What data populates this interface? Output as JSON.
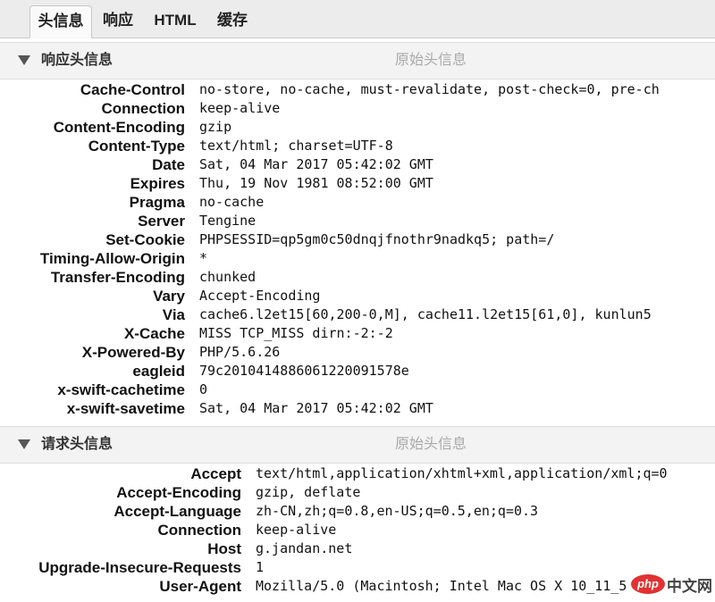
{
  "tabs": [
    "头信息",
    "响应",
    "HTML",
    "缓存"
  ],
  "response_section": {
    "title": "响应头信息",
    "raw_label": "原始头信息",
    "headers": [
      {
        "k": "Cache-Control",
        "v": "no-store, no-cache, must-revalidate, post-check=0, pre-ch"
      },
      {
        "k": "Connection",
        "v": "keep-alive"
      },
      {
        "k": "Content-Encoding",
        "v": "gzip"
      },
      {
        "k": "Content-Type",
        "v": "text/html; charset=UTF-8"
      },
      {
        "k": "Date",
        "v": "Sat, 04 Mar 2017 05:42:02 GMT"
      },
      {
        "k": "Expires",
        "v": "Thu, 19 Nov 1981 08:52:00 GMT"
      },
      {
        "k": "Pragma",
        "v": "no-cache"
      },
      {
        "k": "Server",
        "v": "Tengine"
      },
      {
        "k": "Set-Cookie",
        "v": "PHPSESSID=qp5gm0c50dnqjfnothr9nadkq5; path=/"
      },
      {
        "k": "Timing-Allow-Origin",
        "v": "*"
      },
      {
        "k": "Transfer-Encoding",
        "v": "chunked"
      },
      {
        "k": "Vary",
        "v": "Accept-Encoding"
      },
      {
        "k": "Via",
        "v": "cache6.l2et15[60,200-0,M], cache11.l2et15[61,0], kunlun5"
      },
      {
        "k": "X-Cache",
        "v": "MISS TCP_MISS dirn:-2:-2"
      },
      {
        "k": "X-Powered-By",
        "v": "PHP/5.6.26"
      },
      {
        "k": "eagleid",
        "v": "79c2010414886061220091578e"
      },
      {
        "k": "x-swift-cachetime",
        "v": "0"
      },
      {
        "k": "x-swift-savetime",
        "v": "Sat, 04 Mar 2017 05:42:02 GMT"
      }
    ]
  },
  "request_section": {
    "title": "请求头信息",
    "raw_label": "原始头信息",
    "headers": [
      {
        "k": "Accept",
        "v": "text/html,application/xhtml+xml,application/xml;q=0"
      },
      {
        "k": "Accept-Encoding",
        "v": "gzip, deflate"
      },
      {
        "k": "Accept-Language",
        "v": "zh-CN,zh;q=0.8,en-US;q=0.5,en;q=0.3"
      },
      {
        "k": "Connection",
        "v": "keep-alive"
      },
      {
        "k": "Host",
        "v": "g.jandan.net"
      },
      {
        "k": "Upgrade-Insecure-Requests",
        "v": "1"
      },
      {
        "k": "User-Agent",
        "v": "Mozilla/5.0 (Macintosh; Intel Mac OS X 10_11_5"
      }
    ]
  },
  "watermark": {
    "logo": "php",
    "text": "中文网"
  }
}
